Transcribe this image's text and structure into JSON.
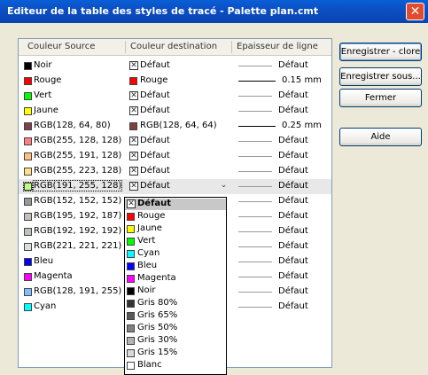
{
  "window": {
    "title": "Editeur de la table des styles de tracé - Palette plan.cmt",
    "close_glyph": "✕"
  },
  "columns": [
    "Couleur Source",
    "Couleur destination",
    "Epaisseur de ligne"
  ],
  "rows": [
    {
      "source": "Noir",
      "src_color": "#000000",
      "dest": "Défaut",
      "dest_color": null,
      "lineweight": "Défaut",
      "lw_thick": false
    },
    {
      "source": "Rouge",
      "src_color": "#ff0000",
      "dest": "Rouge",
      "dest_color": "#ff0000",
      "lineweight": "0.15 mm",
      "lw_thick": true
    },
    {
      "source": "Vert",
      "src_color": "#00ff00",
      "dest": "Défaut",
      "dest_color": null,
      "lineweight": "Défaut",
      "lw_thick": false
    },
    {
      "source": "Jaune",
      "src_color": "#ffff00",
      "dest": "Défaut",
      "dest_color": null,
      "lineweight": "Défaut",
      "lw_thick": false
    },
    {
      "source": "RGB(128, 64, 80)",
      "src_color": "#804050",
      "dest": "RGB(128, 64, 64)",
      "dest_color": "#804040",
      "lineweight": "0.25 mm",
      "lw_thick": true
    },
    {
      "source": "RGB(255, 128, 128)",
      "src_color": "#ff8080",
      "dest": "Défaut",
      "dest_color": null,
      "lineweight": "Défaut",
      "lw_thick": false
    },
    {
      "source": "RGB(255, 191, 128)",
      "src_color": "#ffbf80",
      "dest": "Défaut",
      "dest_color": null,
      "lineweight": "Défaut",
      "lw_thick": false
    },
    {
      "source": "RGB(255, 223, 128)",
      "src_color": "#ffdf80",
      "dest": "Défaut",
      "dest_color": null,
      "lineweight": "Défaut",
      "lw_thick": false
    },
    {
      "source": "RGB(191, 255, 128)",
      "src_color": "#bfff80",
      "dest": "Défaut",
      "dest_color": null,
      "lineweight": "Défaut",
      "lw_thick": false,
      "selected": true
    },
    {
      "source": "RGB(152, 152, 152)",
      "src_color": "#989898",
      "dest": "",
      "dest_color": null,
      "lineweight": "Défaut",
      "lw_thick": false
    },
    {
      "source": "RGB(195, 192, 187)",
      "src_color": "#c3c0bb",
      "dest": "",
      "dest_color": null,
      "lineweight": "Défaut",
      "lw_thick": false
    },
    {
      "source": "RGB(192, 192, 192)",
      "src_color": "#c0c0c0",
      "dest": "",
      "dest_color": null,
      "lineweight": "Défaut",
      "lw_thick": false
    },
    {
      "source": "RGB(221, 221, 221)",
      "src_color": "#dddddd",
      "dest": "",
      "dest_color": null,
      "lineweight": "Défaut",
      "lw_thick": false
    },
    {
      "source": "Bleu",
      "src_color": "#0000ff",
      "dest": "",
      "dest_color": null,
      "lineweight": "Défaut",
      "lw_thick": false
    },
    {
      "source": "Magenta",
      "src_color": "#ff00ff",
      "dest": "",
      "dest_color": null,
      "lineweight": "Défaut",
      "lw_thick": false
    },
    {
      "source": "RGB(128, 191, 255)",
      "src_color": "#80bfff",
      "dest": "",
      "dest_color": null,
      "lineweight": "Défaut",
      "lw_thick": false
    },
    {
      "source": "Cyan",
      "src_color": "#00ffff",
      "dest": "",
      "dest_color": null,
      "lineweight": "Défaut",
      "lw_thick": false
    }
  ],
  "dropdown": {
    "arrow_glyph": "⌄",
    "items": [
      {
        "label": "Défaut",
        "color": null,
        "highlighted": true
      },
      {
        "label": "Rouge",
        "color": "#ff0000"
      },
      {
        "label": "Jaune",
        "color": "#ffff00"
      },
      {
        "label": "Vert",
        "color": "#00ff00"
      },
      {
        "label": "Cyan",
        "color": "#00ffff"
      },
      {
        "label": "Bleu",
        "color": "#0000ff"
      },
      {
        "label": "Magenta",
        "color": "#ff00ff"
      },
      {
        "label": "Noir",
        "color": "#000000"
      },
      {
        "label": "Gris 80%",
        "color": "#333333"
      },
      {
        "label": "Gris 65%",
        "color": "#595959"
      },
      {
        "label": "Gris 50%",
        "color": "#808080"
      },
      {
        "label": "Gris 30%",
        "color": "#b3b3b3"
      },
      {
        "label": "Gris 15%",
        "color": "#d9d9d9"
      },
      {
        "label": "Blanc",
        "color": "#ffffff"
      }
    ]
  },
  "buttons": {
    "save_close": "Enregistrer - clore",
    "save_as": "Enregistrer sous...",
    "close": "Fermer",
    "help": "Aide"
  }
}
